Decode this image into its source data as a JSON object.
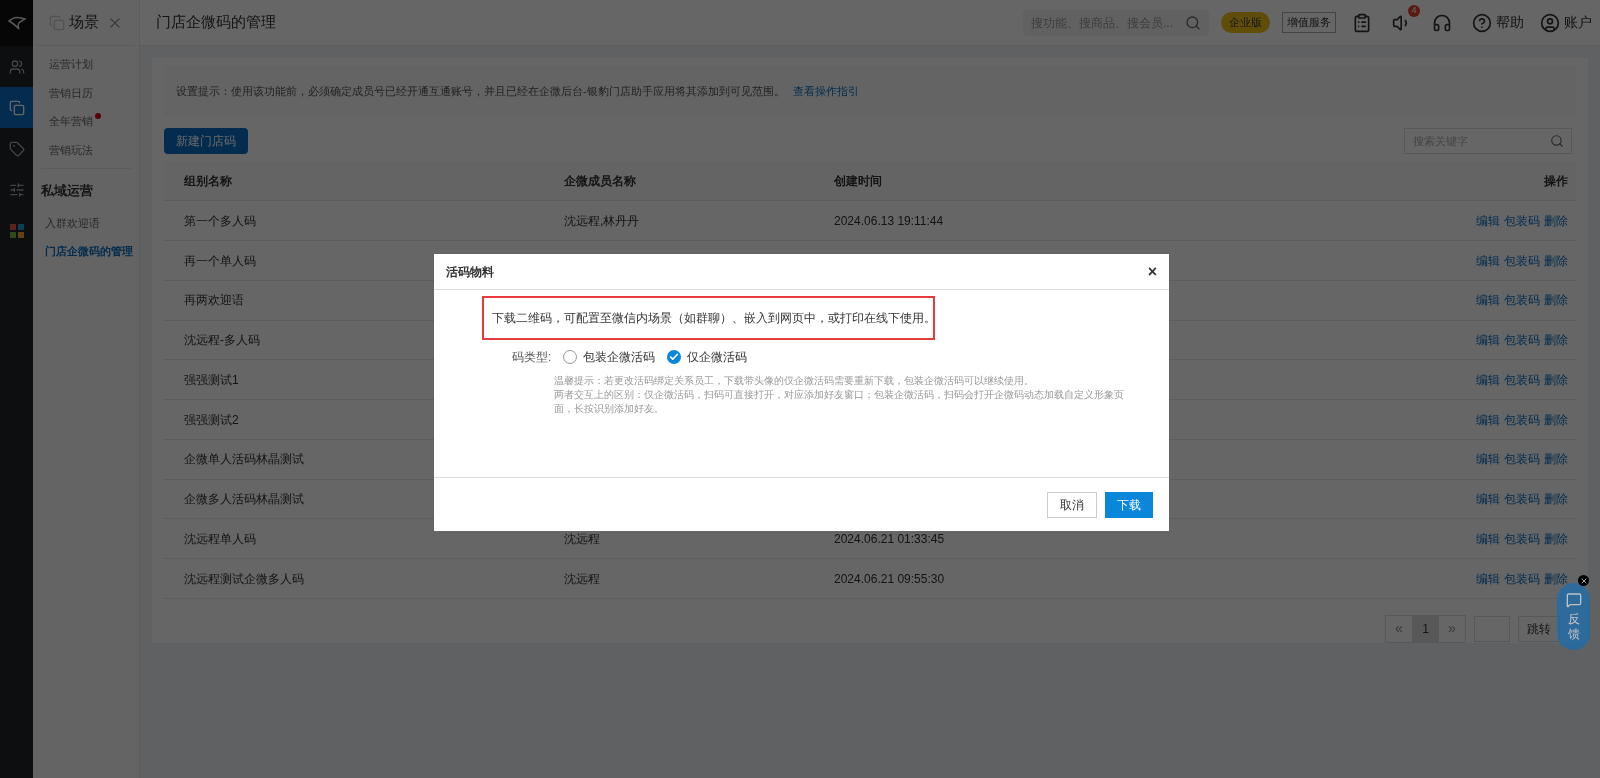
{
  "rail": [
    {
      "kind": "people",
      "selected": false
    },
    {
      "kind": "copy",
      "selected": true
    },
    {
      "kind": "tag",
      "selected": false
    },
    {
      "kind": "sliders",
      "selected": false
    },
    {
      "kind": "apps",
      "selected": false
    }
  ],
  "sidebar": {
    "title": "场景",
    "groups": [
      {
        "items": [
          {
            "label": "运营计划",
            "selected": false,
            "dot": false
          },
          {
            "label": "营销日历",
            "selected": false,
            "dot": false
          },
          {
            "label": "全年营销",
            "selected": false,
            "dot": true
          },
          {
            "label": "营销玩法",
            "selected": false,
            "dot": false
          }
        ]
      },
      {
        "heading": "私域运营",
        "items": [
          {
            "label": "入群欢迎语",
            "selected": false,
            "dot": false
          },
          {
            "label": "门店企微码的管理",
            "selected": true,
            "dot": false
          }
        ]
      }
    ]
  },
  "topbar": {
    "title": "门店企微码的管理",
    "search": {
      "placeholder": "搜功能、搜商品、搜会员..."
    },
    "edition": "企业版",
    "service": "增值服务",
    "notice_count": "4",
    "help": "帮助",
    "account": "账户"
  },
  "tip": {
    "text": "设置提示：使用该功能前，必须确定成员号已经开通互通账号，并且已经在企微后台-银豹门店助手应用将其添加到可见范围。",
    "link": "查看操作指引"
  },
  "new_button": "新建门店码",
  "table_search": {
    "placeholder": "搜索关键字"
  },
  "table": {
    "columns": [
      "组别名称",
      "企微成员名称",
      "创建时间",
      "操作"
    ],
    "rows": [
      {
        "name": "第一个多人码",
        "member": "沈远程,林丹丹",
        "created": "2024.06.13 19:11:44",
        "actions": [
          "编辑",
          "包装码",
          "删除"
        ]
      },
      {
        "name": "再一个单人码",
        "actions": [
          "编辑",
          "包装码",
          "删除"
        ]
      },
      {
        "name": "再两欢迎语",
        "actions": [
          "编辑",
          "包装码",
          "删除"
        ]
      },
      {
        "name": "沈远程-多人码",
        "actions": [
          "编辑",
          "包装码",
          "删除"
        ]
      },
      {
        "name": "强强测试1",
        "actions": [
          "编辑",
          "包装码",
          "删除"
        ]
      },
      {
        "name": "强强测试2",
        "actions": [
          "编辑",
          "包装码",
          "删除"
        ]
      },
      {
        "name": "企微单人活码林晶测试",
        "actions": [
          "编辑",
          "包装码",
          "删除"
        ]
      },
      {
        "name": "企微多人活码林晶测试",
        "actions": [
          "编辑",
          "包装码",
          "删除"
        ]
      },
      {
        "name": "沈远程单人码",
        "member": "沈远程",
        "created": "2024.06.21 01:33:45",
        "actions": [
          "编辑",
          "包装码",
          "删除"
        ]
      },
      {
        "name": "沈远程测试企微多人码",
        "member": "沈远程",
        "created": "2024.06.21 09:55:30",
        "actions": [
          "编辑",
          "包装码",
          "删除"
        ]
      }
    ]
  },
  "pagination": {
    "prev": "«",
    "pages": [
      {
        "label": "1",
        "selected": true
      }
    ],
    "next": "»",
    "jump": "跳转"
  },
  "feedback": {
    "label": "反馈"
  },
  "modal": {
    "title": "活码物料",
    "close": "×",
    "notice": "下载二维码，可配置至微信内场景（如群聊）、嵌入到网页中，或打印在线下使用。",
    "type_label": "码类型:",
    "options": [
      {
        "label": "包装企微活码",
        "selected": false
      },
      {
        "label": "仅企微活码",
        "selected": true
      }
    ],
    "hints": [
      "温馨提示：若更改活码绑定关系员工，下载带头像的仅企微活码需要重新下载，包装企微活码可以继续使用。",
      "两者交互上的区别：仅企微活码，扫码可直接打开，对应添加好友窗口；包装企微活码，扫码会打开企微码动态加载自定义形象页面，长按识别添加好友。"
    ],
    "cancel": "取消",
    "confirm": "下载"
  }
}
